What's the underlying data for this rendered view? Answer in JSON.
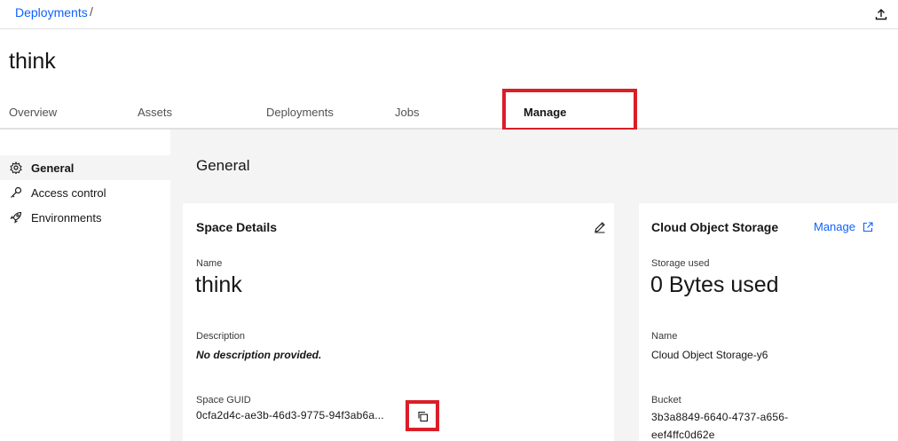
{
  "breadcrumb": {
    "link": "Deployments",
    "separator": "/"
  },
  "page": {
    "title": "think"
  },
  "tabs": [
    {
      "label": "Overview"
    },
    {
      "label": "Assets"
    },
    {
      "label": "Deployments"
    },
    {
      "label": "Jobs"
    },
    {
      "label": "Manage",
      "active": true
    }
  ],
  "sidebar": {
    "items": [
      {
        "label": "General",
        "icon": "gear-icon",
        "active": true
      },
      {
        "label": "Access control",
        "icon": "key-icon"
      },
      {
        "label": "Environments",
        "icon": "rocket-icon"
      }
    ]
  },
  "main": {
    "title": "General"
  },
  "space_details": {
    "title": "Space Details",
    "name_label": "Name",
    "name_value": "think",
    "description_label": "Description",
    "description_value": "No description provided.",
    "guid_label": "Space GUID",
    "guid_value": "0cfa2d4c-ae3b-46d3-9775-94f3ab6a..."
  },
  "cos": {
    "title": "Cloud Object Storage",
    "manage_label": "Manage",
    "storage_label": "Storage used",
    "storage_value": "0 Bytes used",
    "name_label": "Name",
    "name_value": "Cloud Object Storage-y6",
    "bucket_label": "Bucket",
    "bucket_line1": "3b3a8849-6640-4737-a656-",
    "bucket_line2": "eef4ffc0d62e"
  },
  "colors": {
    "link": "#0f62fe",
    "highlight": "#da1e28",
    "background": "#f4f4f4"
  }
}
